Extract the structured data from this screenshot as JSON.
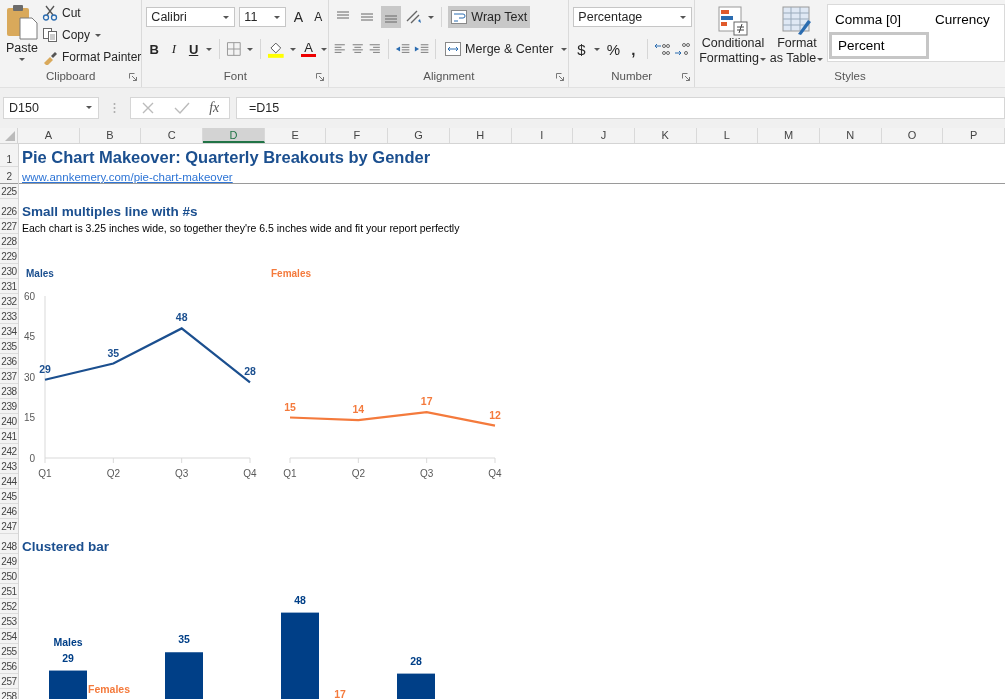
{
  "ribbon": {
    "clipboard": {
      "label": "Clipboard",
      "paste": "Paste",
      "cut": "Cut",
      "copy": "Copy",
      "format_painter": "Format Painter"
    },
    "font": {
      "label": "Font",
      "family": "Calibri",
      "size": "11",
      "grow": "A",
      "shrink": "A",
      "bold": "B",
      "italic": "I",
      "underline": "U",
      "font_color": "A"
    },
    "alignment": {
      "label": "Alignment",
      "vertical": [
        {
          "selected": false
        },
        {
          "selected": false
        },
        {
          "selected": true
        }
      ],
      "wrap_text": {
        "label": "Wrap Text",
        "on": true
      },
      "merge": "Merge & Center"
    },
    "number": {
      "label": "Number",
      "format": "Percentage",
      "currency": "$",
      "percent": "%",
      "comma": ","
    },
    "styles": {
      "label": "Styles",
      "conditional": "Conditional Formatting",
      "format_table": "Format as Table",
      "cells": [
        {
          "label": "Comma [0]",
          "selected": false
        },
        {
          "label": "Currency",
          "selected": false
        },
        {
          "label": "Percent",
          "selected": true
        }
      ]
    }
  },
  "formula_bar": {
    "name_box": "D150",
    "fx": "fx",
    "formula": "=D15"
  },
  "columns": [
    {
      "label": "A",
      "selected": false
    },
    {
      "label": "B",
      "selected": false
    },
    {
      "label": "C",
      "selected": false
    },
    {
      "label": "D",
      "selected": true
    },
    {
      "label": "E",
      "selected": false
    },
    {
      "label": "F",
      "selected": false
    },
    {
      "label": "G",
      "selected": false
    },
    {
      "label": "H",
      "selected": false
    },
    {
      "label": "I",
      "selected": false
    },
    {
      "label": "J",
      "selected": false
    },
    {
      "label": "K",
      "selected": false
    },
    {
      "label": "L",
      "selected": false
    },
    {
      "label": "M",
      "selected": false
    },
    {
      "label": "N",
      "selected": false
    },
    {
      "label": "O",
      "selected": false
    },
    {
      "label": "P",
      "selected": false
    }
  ],
  "rows": [
    {
      "num": "1",
      "kind": "title",
      "text": "Pie Chart Makeover: Quarterly Breakouts by Gender"
    },
    {
      "num": "2",
      "kind": "link",
      "text": "www.annkemery.com/pie-chart-makeover"
    },
    {
      "num": "225"
    },
    {
      "num": "226",
      "kind": "heading",
      "text": "Small multiples line with #s"
    },
    {
      "num": "227",
      "kind": "note",
      "text": "Each chart is 3.25 inches wide, so together they're 6.5 inches wide and fit your report perfectly"
    },
    {
      "num": "228"
    },
    {
      "num": "229"
    },
    {
      "num": "230"
    },
    {
      "num": "231"
    },
    {
      "num": "232"
    },
    {
      "num": "233"
    },
    {
      "num": "234"
    },
    {
      "num": "235"
    },
    {
      "num": "236"
    },
    {
      "num": "237"
    },
    {
      "num": "238"
    },
    {
      "num": "239"
    },
    {
      "num": "240"
    },
    {
      "num": "241"
    },
    {
      "num": "242"
    },
    {
      "num": "243"
    },
    {
      "num": "244"
    },
    {
      "num": "245"
    },
    {
      "num": "246"
    },
    {
      "num": "247"
    },
    {
      "num": "248",
      "kind": "heading",
      "text": "Clustered bar"
    },
    {
      "num": "249"
    },
    {
      "num": "250"
    },
    {
      "num": "251"
    },
    {
      "num": "252"
    },
    {
      "num": "253"
    },
    {
      "num": "254"
    },
    {
      "num": "255"
    },
    {
      "num": "256"
    },
    {
      "num": "257"
    },
    {
      "num": "258"
    }
  ],
  "charts": [
    {
      "chart_data": {
        "type": "line",
        "title": "Males",
        "categories": [
          "Q1",
          "Q2",
          "Q3",
          "Q4"
        ],
        "ylim": [
          0,
          60
        ],
        "yticks": [
          0,
          15,
          30,
          45,
          60
        ],
        "data_labels": true,
        "series": [
          {
            "color": "#1b4f8f",
            "values": [
              29,
              35,
              48,
              28
            ]
          }
        ]
      }
    },
    {
      "chart_data": {
        "type": "line",
        "title": "Females",
        "categories": [
          "Q1",
          "Q2",
          "Q3",
          "Q4"
        ],
        "ylim": [
          0,
          60
        ],
        "data_labels": true,
        "series": [
          {
            "color": "#f47a3c",
            "values": [
              15,
              14,
              17,
              12
            ]
          }
        ]
      }
    },
    {
      "chart_data": {
        "type": "bar",
        "orientation": "vertical",
        "stacked": false,
        "categories": [
          null,
          null,
          null,
          null
        ],
        "data_labels": true,
        "series": [
          {
            "name": "Males",
            "color": "#003f87",
            "values": [
              29,
              35,
              48,
              28
            ]
          }
        ],
        "annotations": [
          "Females",
          "17"
        ]
      }
    }
  ]
}
